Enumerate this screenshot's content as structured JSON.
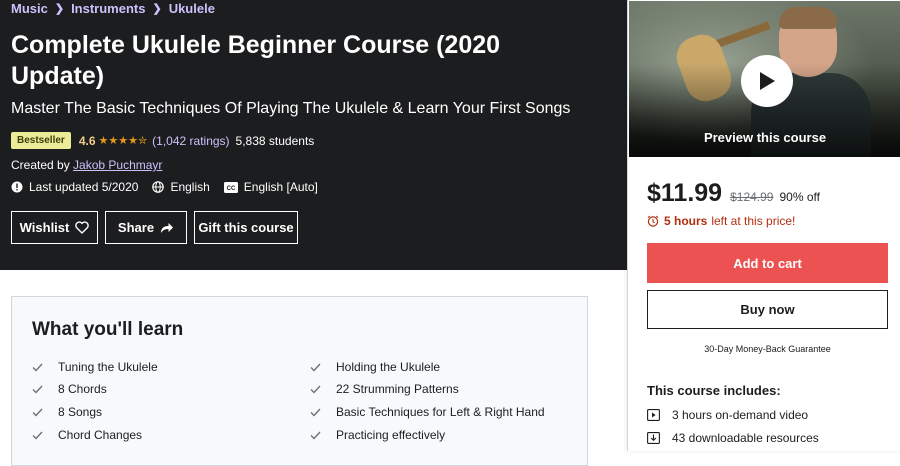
{
  "breadcrumb": [
    "Music",
    "Instruments",
    "Ukulele"
  ],
  "course": {
    "title": "Complete Ukulele Beginner Course (2020 Update)",
    "subtitle": "Master The Basic Techniques Of Playing The Ukulele & Learn Your First Songs",
    "badge": "Bestseller",
    "rating": "4.6",
    "stars_value": 4.5,
    "ratings_count": "(1,042 ratings)",
    "students": "5,838 students",
    "created_by_label": "Created by",
    "instructor": "Jakob Puchmayr",
    "last_updated": "Last updated 5/2020",
    "language": "English",
    "captions": "English [Auto]"
  },
  "actions": {
    "wishlist": "Wishlist",
    "share": "Share",
    "gift": "Gift this course"
  },
  "sidebar": {
    "preview_label": "Preview this course",
    "price": "$11.99",
    "original_price": "$124.99",
    "discount": "90% off",
    "time_left_hours": "5 hours",
    "time_left_suffix": "left at this price!",
    "add_to_cart": "Add to cart",
    "buy_now": "Buy now",
    "guarantee": "30-Day Money-Back Guarantee",
    "includes_title": "This course includes:",
    "includes": [
      "3 hours on-demand video",
      "43 downloadable resources"
    ]
  },
  "learn": {
    "title": "What you'll learn",
    "left_items": [
      "Tuning the Ukulele",
      "8 Chords",
      "8 Songs",
      "Chord Changes"
    ],
    "right_items": [
      "Holding the Ukulele",
      "22 Strumming Patterns",
      "Basic Techniques for Left & Right Hand",
      "Practicing effectively"
    ]
  },
  "colors": {
    "hero_bg": "#1c1d1f",
    "link_purple": "#cec0fc",
    "badge_bg": "#eceb98",
    "star": "#e59819",
    "cta_red": "#ec5252",
    "urgency_red": "#b32d0f"
  },
  "icons": {
    "updated": "alert-badge-icon",
    "language": "globe-icon",
    "captions": "closed-captions-icon",
    "wishlist": "heart-icon",
    "share": "share-arrow-icon",
    "play": "play-icon",
    "timer": "alarm-clock-icon",
    "check": "checkmark-icon",
    "video": "video-icon",
    "resources": "file-icon"
  }
}
